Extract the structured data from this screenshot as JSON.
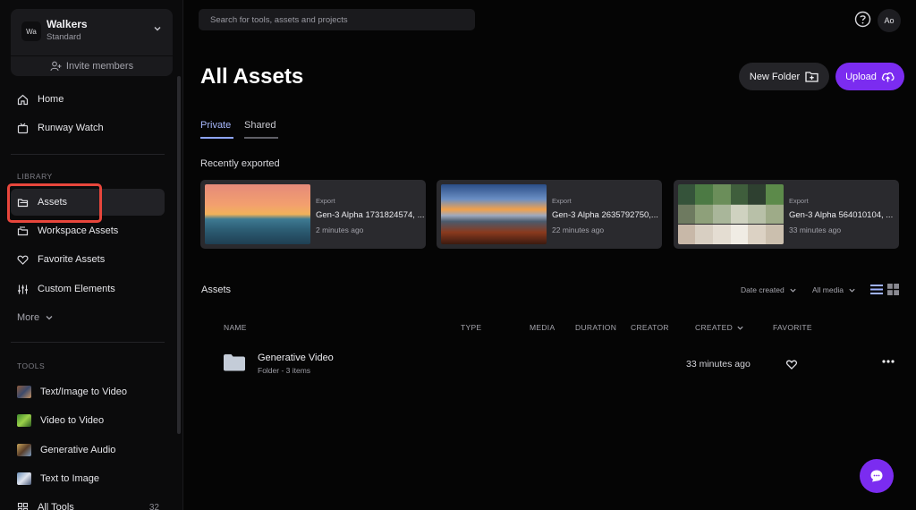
{
  "workspace": {
    "avatar": "Wa",
    "name": "Walkers",
    "plan": "Standard",
    "invite_label": "Invite members"
  },
  "sidebar": {
    "nav": [
      {
        "label": "Home",
        "icon": "home-icon"
      },
      {
        "label": "Runway Watch",
        "icon": "tv-icon"
      }
    ],
    "library_label": "LIBRARY",
    "library": [
      {
        "label": "Assets",
        "icon": "folder-icon",
        "active": true
      },
      {
        "label": "Workspace Assets",
        "icon": "workspace-icon"
      },
      {
        "label": "Favorite Assets",
        "icon": "heart-icon"
      },
      {
        "label": "Custom Elements",
        "icon": "sliders-icon"
      },
      {
        "label": "More",
        "icon": "chevron-down-icon"
      }
    ],
    "tools_label": "TOOLS",
    "tools": [
      {
        "label": "Text/Image to Video"
      },
      {
        "label": "Video to Video"
      },
      {
        "label": "Generative Audio"
      },
      {
        "label": "Text to Image"
      },
      {
        "label": "All Tools",
        "count": "32"
      }
    ]
  },
  "search": {
    "placeholder": "Search for tools, assets and projects"
  },
  "user": {
    "initials": "Ao"
  },
  "page": {
    "title": "All Assets",
    "new_folder_label": "New Folder",
    "upload_label": "Upload"
  },
  "tabs": [
    {
      "label": "Private",
      "active": true
    },
    {
      "label": "Shared",
      "active": false
    }
  ],
  "recent": {
    "label": "Recently exported",
    "items": [
      {
        "type": "Export",
        "title": "Gen-3 Alpha 1731824574, ...",
        "time": "2 minutes ago"
      },
      {
        "type": "Export",
        "title": "Gen-3 Alpha 2635792750,...",
        "time": "22 minutes ago"
      },
      {
        "type": "Export",
        "title": "Gen-3 Alpha 564010104, ...",
        "time": "33 minutes ago"
      }
    ]
  },
  "assets": {
    "label": "Assets",
    "sort_label": "Date created",
    "media_filter": "All media",
    "columns": {
      "name": "NAME",
      "type": "TYPE",
      "media": "MEDIA",
      "duration": "DURATION",
      "creator": "CREATOR",
      "created": "CREATED",
      "favorite": "FAVORITE"
    },
    "rows": [
      {
        "name": "Generative Video",
        "meta": "Folder - 3 items",
        "created": "33 minutes ago"
      }
    ]
  },
  "colors": {
    "accent": "#7b2cf0",
    "tab_active": "#8ea5ff",
    "highlight": "#e8463c"
  }
}
